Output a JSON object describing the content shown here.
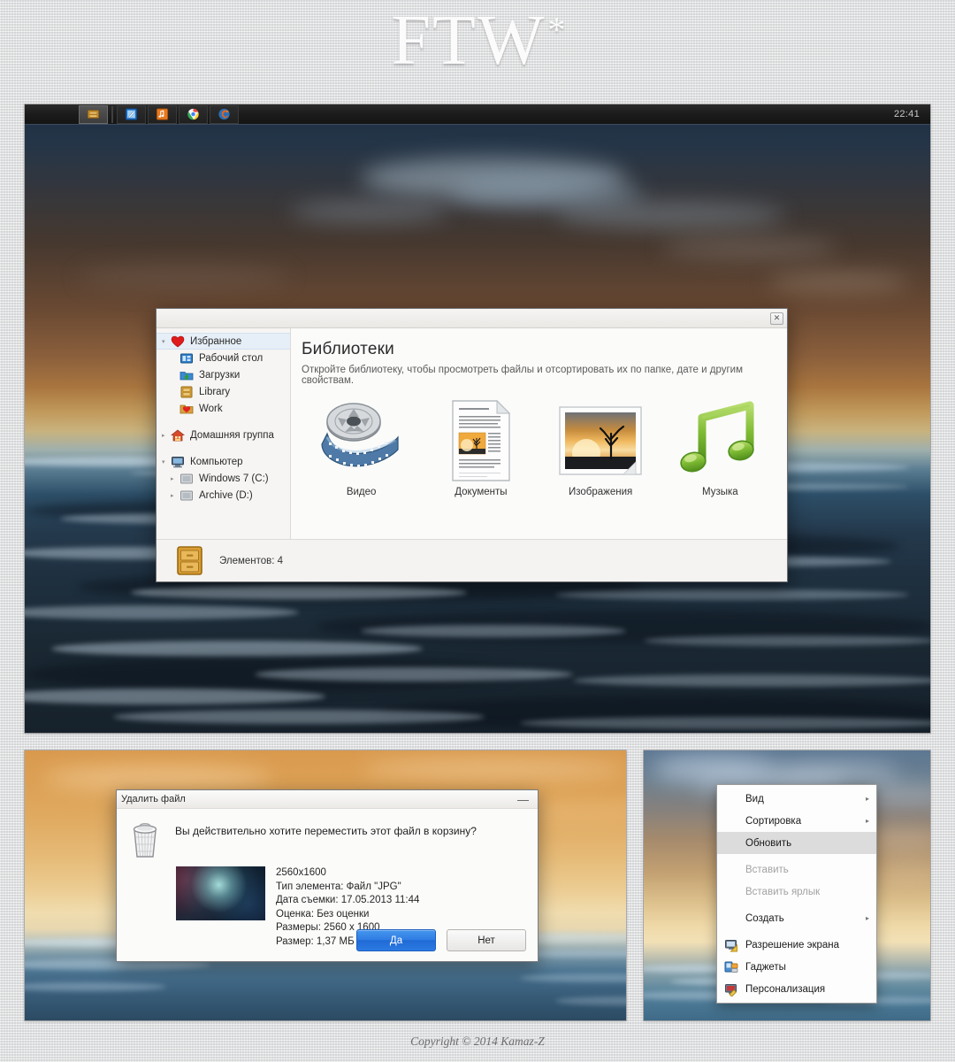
{
  "header": {
    "logo": "FTW",
    "logo_star": "*"
  },
  "taskbar": {
    "clock": "22:41",
    "buttons": [
      {
        "name": "explorer",
        "label": "Проводник",
        "icon": "folder-drawer-icon",
        "active": true
      },
      {
        "name": "notepad",
        "label": "Блокнот",
        "icon": "notepad-pen-icon",
        "active": false
      },
      {
        "name": "music",
        "label": "Музыкальный проигрыватель",
        "icon": "music-note-icon",
        "active": false
      },
      {
        "name": "chrome",
        "label": "Google Chrome",
        "icon": "chrome-icon",
        "active": false
      },
      {
        "name": "firefox",
        "label": "Mozilla Firefox",
        "icon": "firefox-icon",
        "active": false
      }
    ]
  },
  "libraries_window": {
    "close_label": "✕",
    "sidebar": [
      {
        "label": "Избранное",
        "icon": "heart-icon",
        "level": 0,
        "selected": true,
        "chevron": "▾"
      },
      {
        "label": "Рабочий стол",
        "icon": "desktop-icon",
        "level": 1,
        "selected": false,
        "chevron": ""
      },
      {
        "label": "Загрузки",
        "icon": "downloads-icon",
        "level": 1,
        "selected": false,
        "chevron": ""
      },
      {
        "label": "Library",
        "icon": "library-cabinet-icon",
        "level": 1,
        "selected": false,
        "chevron": ""
      },
      {
        "label": "Work",
        "icon": "work-folder-icon",
        "level": 1,
        "selected": false,
        "chevron": ""
      },
      {
        "label": "Домашняя группа",
        "icon": "homegroup-icon",
        "level": 0,
        "selected": false,
        "chevron": "▸"
      },
      {
        "label": "Компьютер",
        "icon": "computer-icon",
        "level": 0,
        "selected": false,
        "chevron": "▾"
      },
      {
        "label": "Windows 7 (C:)",
        "icon": "drive-icon",
        "level": 1,
        "selected": false,
        "chevron": "▸"
      },
      {
        "label": "Archive (D:)",
        "icon": "drive-icon",
        "level": 1,
        "selected": false,
        "chevron": "▸"
      }
    ],
    "title": "Библиотеки",
    "subtitle": "Откройте библиотеку, чтобы просмотреть файлы и отсортировать их по папке, дате и другим свойствам.",
    "items": [
      {
        "label": "Видео",
        "icon": "film-reel-icon"
      },
      {
        "label": "Документы",
        "icon": "document-icon"
      },
      {
        "label": "Изображения",
        "icon": "picture-icon"
      },
      {
        "label": "Музыка",
        "icon": "music-notes-icon"
      }
    ],
    "status": {
      "icon": "library-cabinet-icon",
      "text": "Элементов: 4"
    }
  },
  "delete_dialog": {
    "title": "Удалить файл",
    "minimize_label": "—",
    "trash_icon": "recycle-bin-icon",
    "question": "Вы действительно хотите переместить этот файл в корзину?",
    "details": [
      "2560x1600",
      "Тип элемента: Файл \"JPG\"",
      "Дата съемки: 17.05.2013 11:44",
      "Оценка: Без оценки",
      "Размеры: 2560 x 1600",
      "Размер: 1,37 МБ"
    ],
    "confirm_label": "Да",
    "cancel_label": "Нет",
    "accent_color": "#2f7ce3"
  },
  "context_menu": {
    "items": [
      {
        "label": "Вид",
        "submenu": true,
        "disabled": false,
        "highlighted": false,
        "icon": ""
      },
      {
        "label": "Сортировка",
        "submenu": true,
        "disabled": false,
        "highlighted": false,
        "icon": ""
      },
      {
        "label": "Обновить",
        "submenu": false,
        "disabled": false,
        "highlighted": true,
        "icon": ""
      },
      {
        "label": "Вставить",
        "submenu": false,
        "disabled": true,
        "highlighted": false,
        "icon": ""
      },
      {
        "label": "Вставить ярлык",
        "submenu": false,
        "disabled": true,
        "highlighted": false,
        "icon": ""
      },
      {
        "label": "Создать",
        "submenu": true,
        "disabled": false,
        "highlighted": false,
        "icon": ""
      },
      {
        "label": "Разрешение экрана",
        "submenu": false,
        "disabled": false,
        "highlighted": false,
        "icon": "screen-resolution-icon"
      },
      {
        "label": "Гаджеты",
        "submenu": false,
        "disabled": false,
        "highlighted": false,
        "icon": "gadgets-icon"
      },
      {
        "label": "Персонализация",
        "submenu": false,
        "disabled": false,
        "highlighted": false,
        "icon": "personalization-icon"
      }
    ],
    "submenu_arrow": "▸"
  },
  "footer": {
    "copyright": "Copyright © 2014 Kamaz-Z"
  }
}
